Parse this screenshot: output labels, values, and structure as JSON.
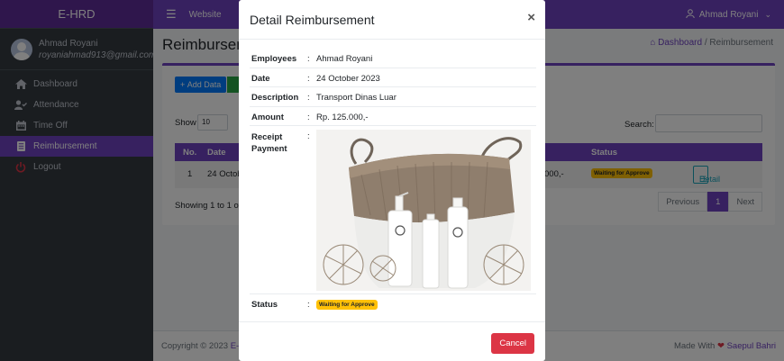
{
  "sidebar": {
    "brand": "E-HRD",
    "user_name": "Ahmad Royani",
    "user_email": "royaniahmad913@gmail.com",
    "items": [
      {
        "label": "Dashboard",
        "icon": "home-icon"
      },
      {
        "label": "Attendance",
        "icon": "user-check-icon"
      },
      {
        "label": "Time Off",
        "icon": "calendar-icon"
      },
      {
        "label": "Reimbursement",
        "icon": "receipt-icon",
        "active": true
      },
      {
        "label": "Logout",
        "icon": "power-icon"
      }
    ]
  },
  "topbar": {
    "menu_icon": "hamburger-icon",
    "link": "Website",
    "user": "Ahmad Royani"
  },
  "page": {
    "title": "Reimbursement",
    "breadcrumb_home": "Dashboard",
    "breadcrumb_sep": "/",
    "breadcrumb_current": "Reimbursement"
  },
  "toolbar": {
    "add_label": "Add Data",
    "show_label": "Show",
    "show_value": "10",
    "search_label": "Search:"
  },
  "table": {
    "headers": [
      "No.",
      "Date",
      "Status"
    ],
    "row": {
      "no": "1",
      "date": "24 October 2023",
      "amount_tail": "000,-",
      "status": "Waiting for Approve",
      "action": "Detail"
    }
  },
  "pagination": {
    "showing": "Showing 1 to 1 of 1",
    "previous": "Previous",
    "page": "1",
    "next": "Next"
  },
  "footer": {
    "copyright": "Copyright © 2023 ",
    "brand_link": "E-HRD",
    "made_with": "Made With ",
    "author": "Saepul Bahri"
  },
  "modal": {
    "title": "Detail Reimbursement",
    "close": "×",
    "fields": {
      "employees_label": "Employees",
      "employees_value": "Ahmad Royani",
      "date_label": "Date",
      "date_value": "24 October 2023",
      "description_label": "Description",
      "description_value": "Transport Dinas Luar",
      "amount_label": "Amount",
      "amount_value": "Rp. 125.000,-",
      "receipt_label_1": "Receipt",
      "receipt_label_2": "Payment",
      "status_label": "Status",
      "status_value": "Waiting for Approve"
    },
    "colon": ":",
    "cancel_label": "Cancel"
  },
  "colors": {
    "primary": "#6f42c1",
    "sidebar": "#343a40",
    "badge_warning": "#ffc107",
    "danger": "#dc3545",
    "info": "#17a2b8"
  }
}
